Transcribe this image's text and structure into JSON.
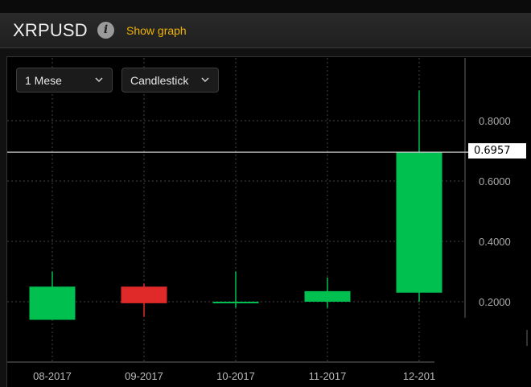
{
  "header": {
    "symbol": "XRPUSD",
    "info_icon_glyph": "i",
    "show_graph_label": "Show graph"
  },
  "controls": {
    "period": {
      "label": "1 Mese"
    },
    "chart_type": {
      "label": "Candlestick"
    }
  },
  "current_price_label": "0.6957",
  "colors": {
    "up": "#00c050",
    "down": "#e02a2a",
    "link": "#f0b400",
    "price_line": "#cccccc"
  },
  "chart_data": {
    "type": "candlestick",
    "categories": [
      "08-2017",
      "09-2017",
      "10-2017",
      "11-2017",
      "12-201"
    ],
    "candles": [
      {
        "open": 0.14,
        "high": 0.3,
        "low": 0.14,
        "close": 0.25
      },
      {
        "open": 0.25,
        "high": 0.26,
        "low": 0.15,
        "close": 0.195
      },
      {
        "open": 0.195,
        "high": 0.3,
        "low": 0.18,
        "close": 0.2
      },
      {
        "open": 0.2,
        "high": 0.28,
        "low": 0.18,
        "close": 0.235
      },
      {
        "open": 0.23,
        "high": 0.9,
        "low": 0.2,
        "close": 0.6957
      }
    ],
    "y_ticks": [
      "0.2000",
      "0.4000",
      "0.6000",
      "0.8000"
    ],
    "y_tick_values": [
      0.2,
      0.4,
      0.6,
      0.8
    ],
    "current_price": 0.6957,
    "ylim": [
      0.0,
      0.9
    ],
    "grid": true
  }
}
